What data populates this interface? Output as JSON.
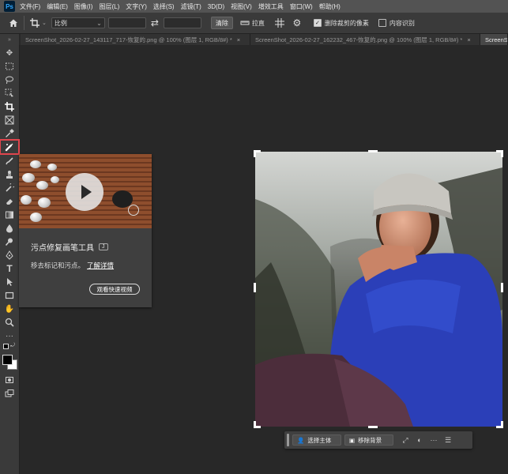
{
  "app": {
    "logo": "Ps"
  },
  "menu": [
    "文件(F)",
    "编辑(E)",
    "图像(I)",
    "图层(L)",
    "文字(Y)",
    "选择(S)",
    "滤镜(T)",
    "3D(D)",
    "视图(V)",
    "增效工具",
    "窗口(W)",
    "帮助(H)"
  ],
  "options": {
    "ratio_select": "比例",
    "clear_button": "清除",
    "straighten_label": "拉直",
    "delete_cropped_label": "删除裁剪的像素",
    "delete_cropped_checked": true,
    "content_aware_label": "内容识别",
    "content_aware_checked": false
  },
  "tabs": [
    {
      "label": "ScreenShot_2026-02-27_143117_717-恢复的.png @ 100% (图层 1, RGB/8#) *",
      "active": false
    },
    {
      "label": "ScreenShot_2026-02-27_162232_467-恢复的.png @ 100% (图层 1, RGB/8#) *",
      "active": false
    },
    {
      "label": "ScreenSh",
      "active": true
    }
  ],
  "tooltip": {
    "title": "污点修复画笔工具",
    "shortcut": "J",
    "description": "移去标记和污点。",
    "link": "了解详情",
    "video_button": "观看快速视频"
  },
  "contextbar": {
    "select_subject": "选择主体",
    "remove_background": "移除背景",
    "more": "···"
  },
  "icons": {
    "home": "home-icon",
    "crop": "crop-icon",
    "swap": "swap-icon",
    "grid": "grid-overlay-icon",
    "gear": "gear-icon",
    "play": "play-icon"
  },
  "colors": {
    "highlight": "#e0454d",
    "ps_blue": "#31a8ff",
    "panel": "#3a3a3a",
    "canvas_bg": "#282828"
  }
}
